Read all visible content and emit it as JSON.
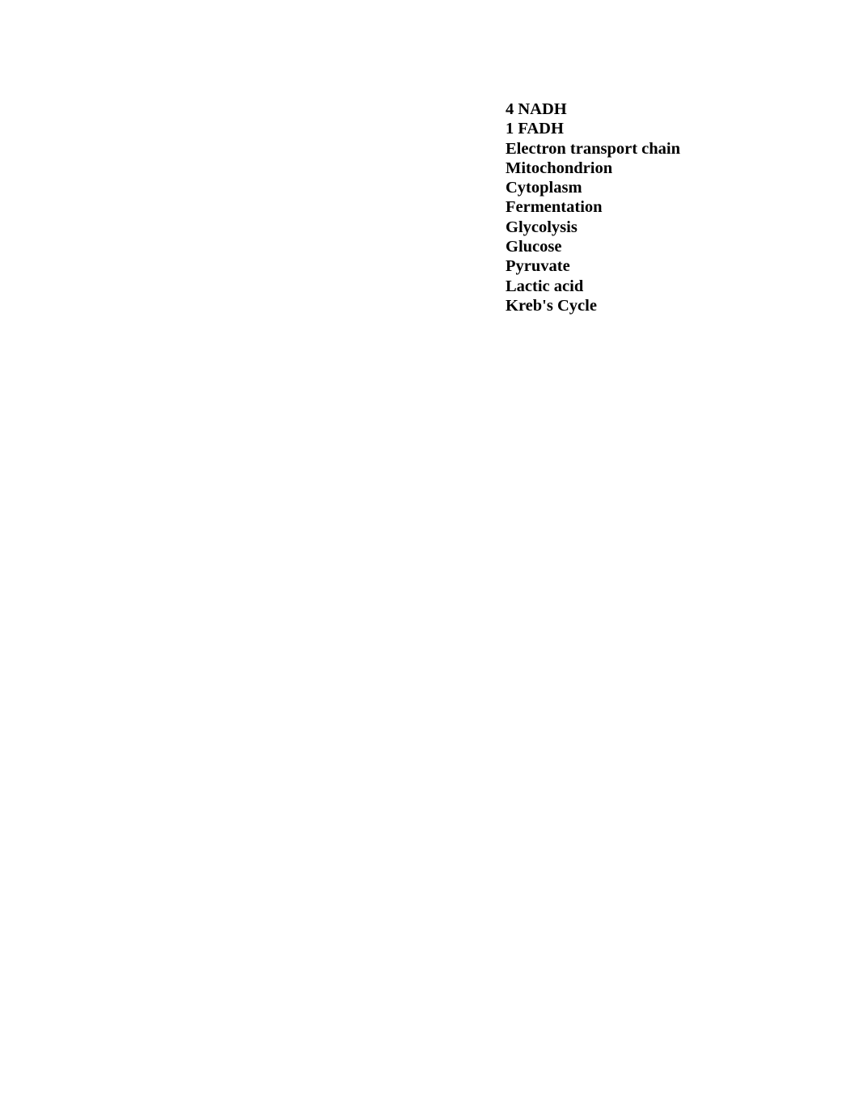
{
  "document": {
    "background_color": "#ffffff",
    "text_color": "#000000",
    "terms": [
      {
        "text": "4 NADH"
      },
      {
        "text": "1 FADH"
      },
      {
        "text": "Electron transport chain"
      },
      {
        "text": "Mitochondrion"
      },
      {
        "text": "Cytoplasm"
      },
      {
        "text": "Fermentation"
      },
      {
        "text": "Glycolysis"
      },
      {
        "text": "Glucose"
      },
      {
        "text": "Pyruvate"
      },
      {
        "text": "Lactic acid"
      },
      {
        "text": "Kreb's Cycle"
      }
    ]
  }
}
